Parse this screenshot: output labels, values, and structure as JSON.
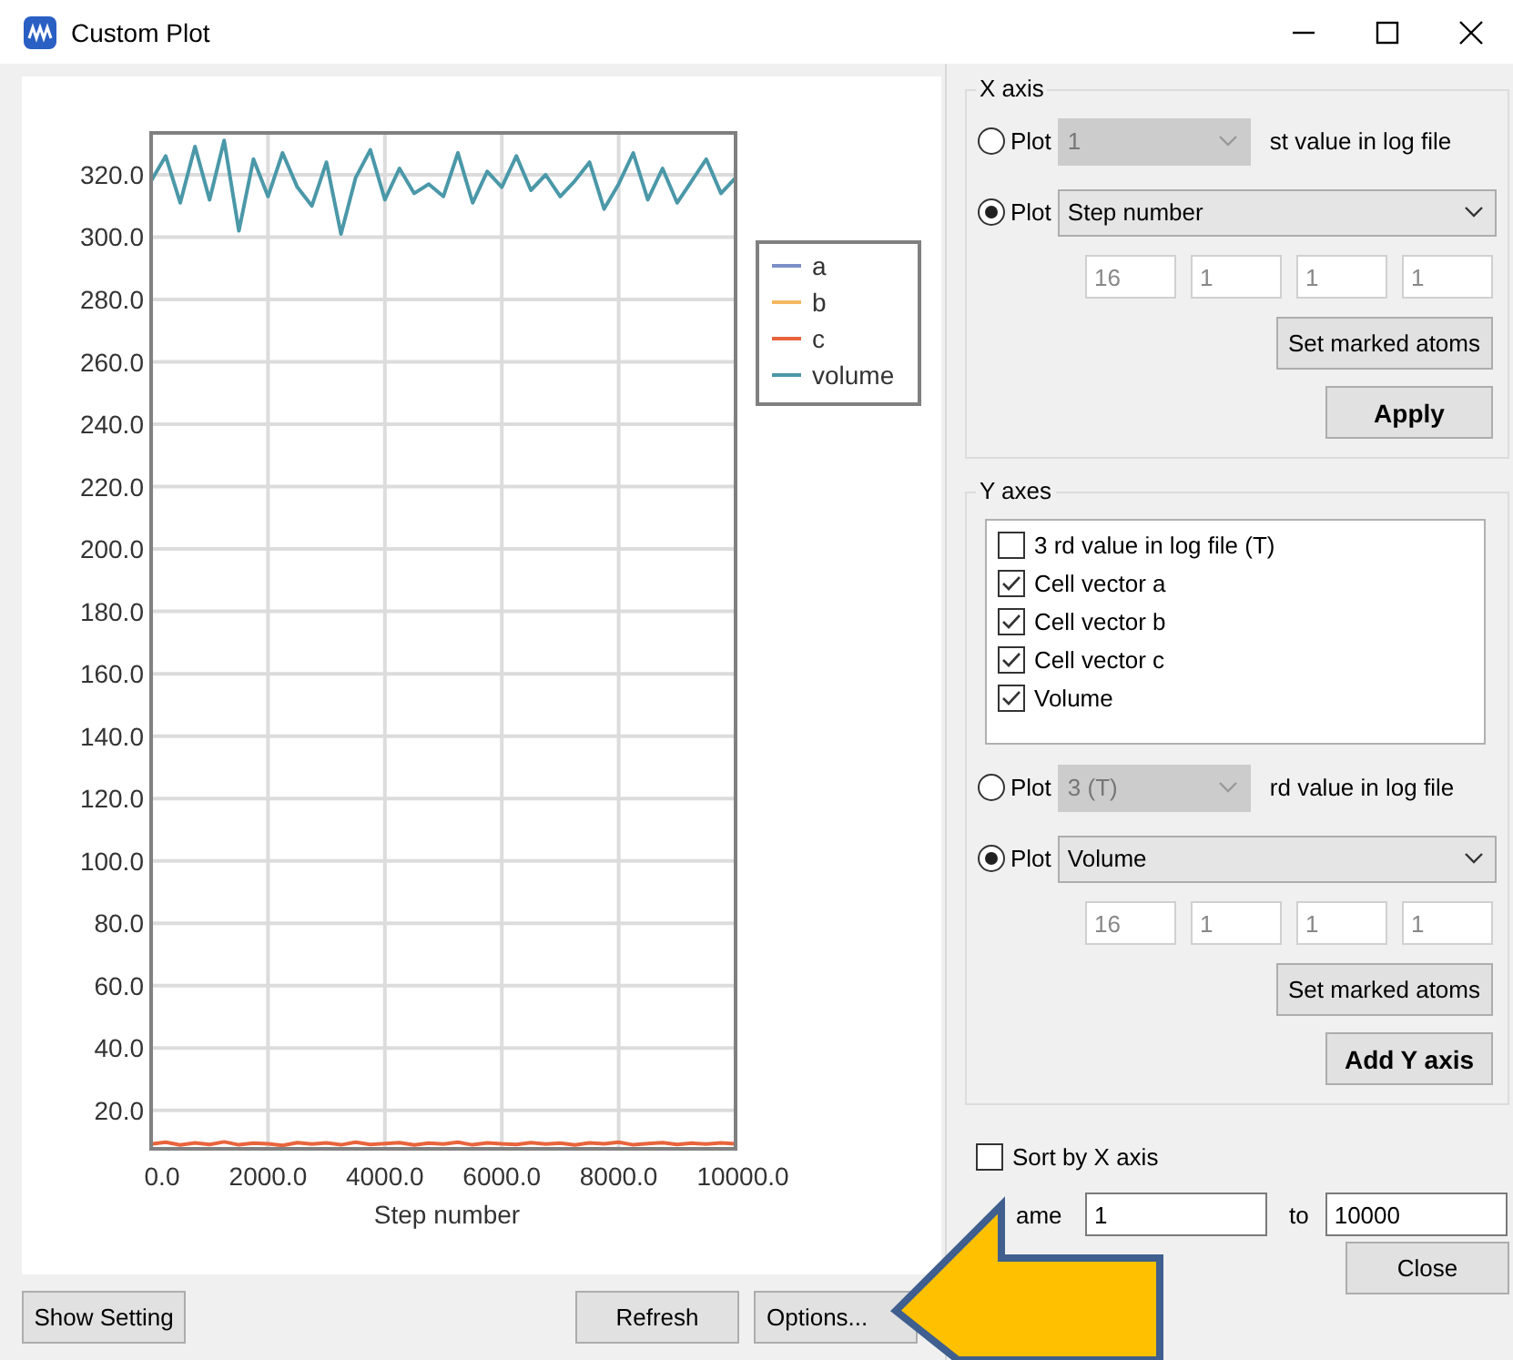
{
  "window": {
    "title": "Custom Plot"
  },
  "plot": {
    "chart_data": {
      "type": "line",
      "xlabel": "Step number",
      "xlim": [
        0,
        10000
      ],
      "ylim": [
        7.7,
        333.4
      ],
      "grid": true,
      "legend": true,
      "xticks": [
        {
          "value": 0,
          "label": "0.0"
        },
        {
          "value": 2000,
          "label": "2000.0"
        },
        {
          "value": 4000,
          "label": "4000.0"
        },
        {
          "value": 6000,
          "label": "6000.0"
        },
        {
          "value": 8000,
          "label": "8000.0"
        },
        {
          "value": 10000,
          "label": "10000.0"
        }
      ],
      "yticks": [
        {
          "value": 20,
          "label": "20.0"
        },
        {
          "value": 40,
          "label": "40.0"
        },
        {
          "value": 60,
          "label": "60.0"
        },
        {
          "value": 80,
          "label": "80.0"
        },
        {
          "value": 100,
          "label": "100.0"
        },
        {
          "value": 120,
          "label": "120.0"
        },
        {
          "value": 140,
          "label": "140.0"
        },
        {
          "value": 160,
          "label": "160.0"
        },
        {
          "value": 180,
          "label": "180.0"
        },
        {
          "value": 200,
          "label": "200.0"
        },
        {
          "value": 220,
          "label": "220.0"
        },
        {
          "value": 240,
          "label": "240.0"
        },
        {
          "value": 260,
          "label": "260.0"
        },
        {
          "value": 280,
          "label": "280.0"
        },
        {
          "value": 300,
          "label": "300.0"
        },
        {
          "value": 320,
          "label": "320.0"
        }
      ],
      "x": [
        0,
        250,
        500,
        750,
        1000,
        1250,
        1500,
        1750,
        2000,
        2250,
        2500,
        2750,
        3000,
        3250,
        3500,
        3750,
        4000,
        4250,
        4500,
        4750,
        5000,
        5250,
        5500,
        5750,
        6000,
        6250,
        6500,
        6750,
        7000,
        7250,
        7500,
        7750,
        8000,
        8250,
        8500,
        8750,
        9000,
        9250,
        9500,
        9750,
        10000
      ],
      "series": [
        {
          "name": "a",
          "color": "#7b8fc8",
          "values": [
            null,
            null,
            null,
            null,
            null,
            null,
            null,
            null,
            null,
            null,
            null,
            null,
            null,
            null,
            null,
            null,
            null,
            null,
            null,
            null,
            null,
            null,
            null,
            null,
            null,
            null,
            null,
            null,
            null,
            null,
            null,
            null,
            null,
            null,
            null,
            null,
            null,
            null,
            null,
            null,
            null
          ]
        },
        {
          "name": "b",
          "color": "#f5b860",
          "values": [
            null,
            null,
            null,
            null,
            null,
            null,
            null,
            null,
            null,
            null,
            null,
            null,
            null,
            null,
            null,
            null,
            null,
            null,
            null,
            null,
            null,
            null,
            null,
            null,
            null,
            null,
            null,
            null,
            null,
            null,
            null,
            null,
            null,
            null,
            null,
            null,
            null,
            null,
            null,
            null,
            null
          ]
        },
        {
          "name": "c",
          "color": "#e8643c",
          "values": [
            9.2,
            9.8,
            8.9,
            9.6,
            9.1,
            9.9,
            9.0,
            9.5,
            9.3,
            8.8,
            9.7,
            9.2,
            9.6,
            9.0,
            9.8,
            9.1,
            9.4,
            9.7,
            8.9,
            9.5,
            9.2,
            9.8,
            9.0,
            9.6,
            9.3,
            9.1,
            9.7,
            9.2,
            9.5,
            8.9,
            9.6,
            9.3,
            9.8,
            9.0,
            9.4,
            9.7,
            9.1,
            9.5,
            9.2,
            9.6,
            9.3
          ]
        },
        {
          "name": "volume",
          "color": "#4a98a8",
          "values": [
            318,
            326,
            311,
            329,
            312,
            331,
            302,
            325,
            313,
            327,
            316,
            310,
            324,
            301,
            319,
            328,
            312,
            322,
            314,
            317,
            313,
            327,
            311,
            321,
            316,
            326,
            315,
            320,
            313,
            318,
            324,
            309,
            317,
            327,
            312,
            322,
            311,
            318,
            325,
            314,
            319
          ]
        }
      ]
    }
  },
  "left_buttons": [
    {
      "label": "Show Setting"
    },
    {
      "label": "Refresh"
    },
    {
      "label": "Options..."
    }
  ],
  "x_axis": {
    "title": "X axis",
    "options": [
      {
        "label": "Plot",
        "selected": false,
        "combo": "1",
        "combo_disabled": true,
        "suffix": "st value in log file"
      },
      {
        "label": "Plot",
        "selected": true,
        "combo": "Step number",
        "combo_disabled": false
      }
    ],
    "fields": [
      "16",
      "1",
      "1",
      "1"
    ],
    "buttons": [
      {
        "label": "Set marked atoms",
        "bold": false
      },
      {
        "label": "Apply",
        "bold": true
      }
    ]
  },
  "y_axes": {
    "title": "Y axes",
    "list": [
      {
        "label": "3 rd value in log file (T)",
        "checked": false
      },
      {
        "label": "Cell vector a",
        "checked": true
      },
      {
        "label": "Cell vector b",
        "checked": true
      },
      {
        "label": "Cell vector c",
        "checked": true
      },
      {
        "label": "Volume",
        "checked": true
      }
    ],
    "options": [
      {
        "label": "Plot",
        "selected": false,
        "combo": "3 (T)",
        "combo_disabled": true,
        "suffix": "rd value in log file"
      },
      {
        "label": "Plot",
        "selected": true,
        "combo": "Volume",
        "combo_disabled": false
      }
    ],
    "fields": [
      "16",
      "1",
      "1",
      "1"
    ],
    "buttons": [
      {
        "label": "Set marked atoms",
        "bold": false
      },
      {
        "label": "Add Y axis",
        "bold": true
      }
    ]
  },
  "sort_by_x": {
    "label": "Sort by X axis",
    "checked": false
  },
  "frame": {
    "label": "ame",
    "from": "1",
    "to_label": "to",
    "to": "10000"
  },
  "close_button": {
    "label": "Close"
  }
}
